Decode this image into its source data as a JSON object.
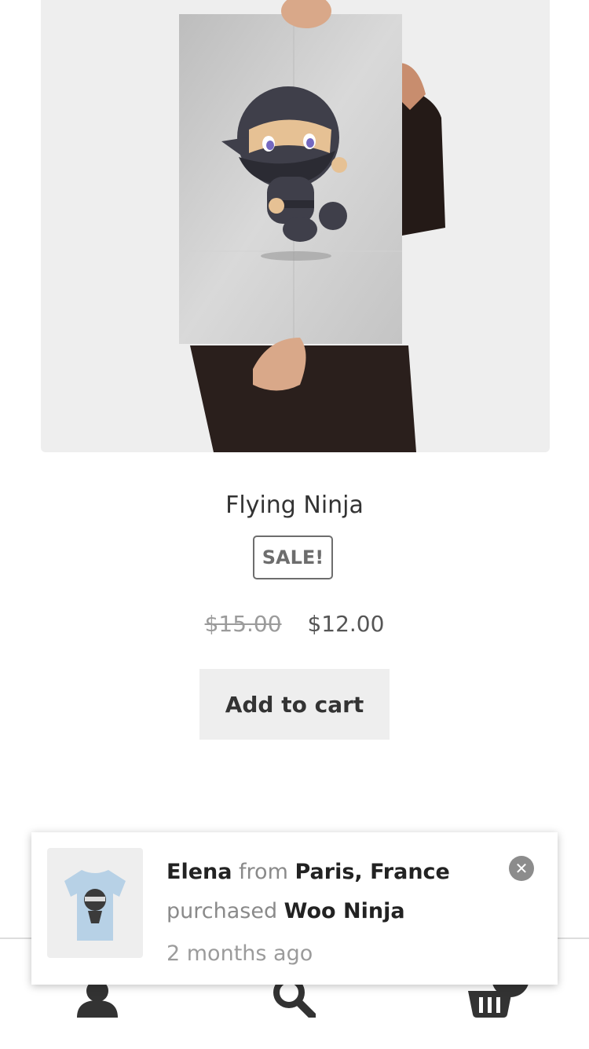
{
  "product": {
    "title": "Flying Ninja",
    "sale_badge": "SALE!",
    "price_old": "$15.00",
    "price_new": "$12.00",
    "add_to_cart_label": "Add to cart",
    "image_icon": "ninja-poster-image"
  },
  "notification": {
    "buyer_name": "Elena",
    "from_word": "from",
    "buyer_location": "Paris, France",
    "purchased_word": "purchased",
    "product_name": "Woo Ninja",
    "time_ago": "2 months ago",
    "close_icon": "close-icon",
    "thumb_icon": "tshirt-thumbnail"
  },
  "bottom_nav": {
    "icons": [
      "account-icon",
      "search-icon",
      "cart-icon"
    ]
  },
  "colors": {
    "image_background": "#eeeeee",
    "button_background": "#eeeeee",
    "text_primary": "#333333",
    "text_muted": "#8a8a8a",
    "badge_border": "#6d6d6d"
  }
}
